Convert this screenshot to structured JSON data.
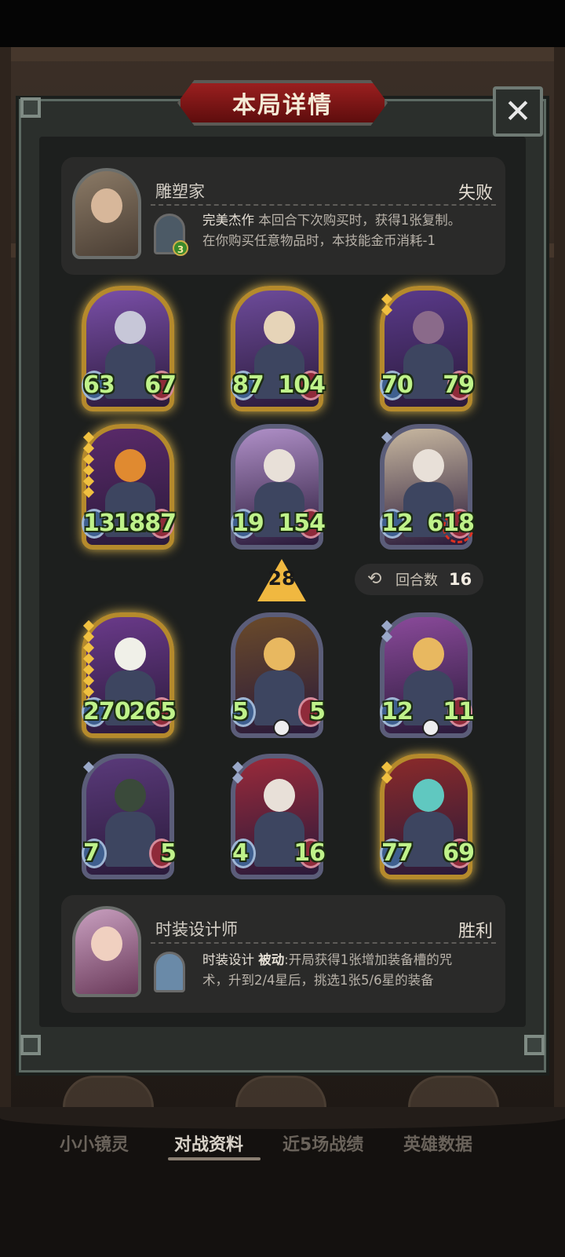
{
  "modal": {
    "title": "本局详情",
    "close_label": "✕"
  },
  "opponent": {
    "name": "雕塑家",
    "result": "失败",
    "skill_level": "3",
    "skill_name": "完美杰作",
    "skill_desc_1": " 本回合下次购买时，获得1张复制。",
    "skill_desc_2": "在你购买任意物品时，本技能金币消耗-1"
  },
  "board_top": [
    {
      "atk": "63",
      "hp": "67",
      "frame": "gold",
      "stars": 0,
      "star_color": "gold",
      "palette": [
        "#7a4fa8",
        "#c7c7d8"
      ]
    },
    {
      "atk": "87",
      "hp": "104",
      "frame": "gold",
      "stars": 0,
      "star_color": "gold",
      "palette": [
        "#6d4b9a",
        "#e6d4b8"
      ]
    },
    {
      "atk": "70",
      "hp": "79",
      "frame": "gold",
      "stars": 2,
      "star_color": "gold",
      "palette": [
        "#5a3a8a",
        "#8a6a8a"
      ]
    },
    {
      "atk": "1312",
      "hp": "1887",
      "frame": "gold",
      "stars": 6,
      "star_color": "gold",
      "palette": [
        "#5a2a6a",
        "#e08a30"
      ]
    },
    {
      "atk": "19",
      "hp": "154",
      "frame": "silver",
      "stars": 0,
      "star_color": "silver",
      "palette": [
        "#b090c8",
        "#e8e0d8"
      ]
    },
    {
      "atk": "12",
      "hp": "618",
      "frame": "silver",
      "stars": 1,
      "star_color": "silver",
      "palette": [
        "#c8b8a0",
        "#e8e0d8"
      ]
    }
  ],
  "level": "28",
  "round": {
    "icon": "⟲",
    "label": "回合数",
    "value": "16"
  },
  "board_bottom": [
    {
      "atk": "270",
      "hp": "265",
      "frame": "gold",
      "stars": 8,
      "star_color": "gold",
      "palette": [
        "#6a3a8a",
        "#f0f0e8"
      ]
    },
    {
      "atk": "5",
      "hp": "5",
      "frame": "silver",
      "stars": 0,
      "star_color": "silver",
      "palette": [
        "#6a4a2a",
        "#e8b860"
      ]
    },
    {
      "atk": "12",
      "hp": "11",
      "frame": "silver",
      "stars": 2,
      "star_color": "silver",
      "palette": [
        "#8a4a9a",
        "#e8b860"
      ]
    },
    {
      "atk": "7",
      "hp": "5",
      "frame": "silver",
      "stars": 1,
      "star_color": "silver",
      "palette": [
        "#5a3a7a",
        "#3a4a3a"
      ]
    },
    {
      "atk": "4",
      "hp": "16",
      "frame": "silver",
      "stars": 2,
      "star_color": "silver",
      "palette": [
        "#9a2a3a",
        "#e8e0d8"
      ]
    },
    {
      "atk": "77",
      "hp": "69",
      "frame": "gold",
      "stars": 2,
      "star_color": "gold",
      "palette": [
        "#8a2a2a",
        "#60c8c0"
      ]
    }
  ],
  "player": {
    "name": "时装设计师",
    "result": "胜利",
    "skill_name": "时装设计",
    "skill_tag": "被动",
    "skill_desc_1": ":开局获得1张增加装备槽的咒",
    "skill_desc_2": "术，升到2/4星后，挑选1张5/6星的装备"
  },
  "tabs": [
    "小小镜灵",
    "对战资料",
    "近5场战绩",
    "英雄数据"
  ],
  "active_tab": 1
}
